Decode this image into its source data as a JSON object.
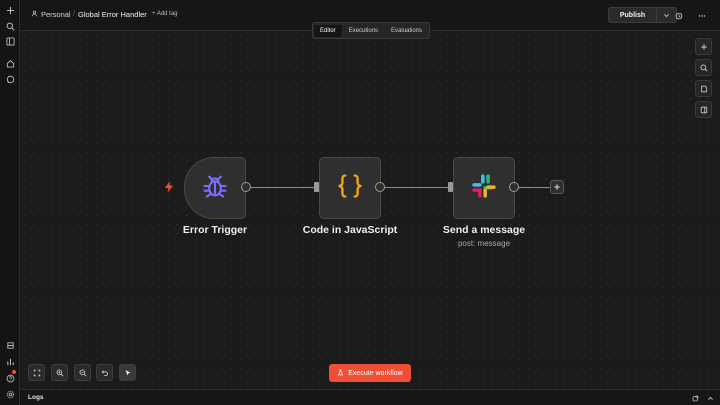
{
  "sidebar": {
    "top_icons": [
      "plus-icon",
      "search-icon",
      "panel-icon",
      "home-icon",
      "chat-icon"
    ],
    "bottom_icons": [
      "templates-icon",
      "insights-icon",
      "help-icon",
      "settings-icon"
    ]
  },
  "header": {
    "project": "Personal",
    "workflow_title": "Global Error Handler",
    "add_tag": "+ Add tag",
    "publish_label": "Publish"
  },
  "tabs": [
    {
      "label": "Editor",
      "active": true
    },
    {
      "label": "Executions",
      "active": false
    },
    {
      "label": "Evaluations",
      "active": false
    }
  ],
  "canvas_tools": [
    "add-node-icon",
    "search-icon",
    "sticky-note-icon",
    "panel-toggle-icon"
  ],
  "nodes": [
    {
      "label": "Error Trigger",
      "subtitle": "",
      "icon": "bug-icon",
      "icon_color": "#7f6cff"
    },
    {
      "label": "Code in JavaScript",
      "subtitle": "",
      "icon": "braces-icon",
      "icon_color": "#f7a21b"
    },
    {
      "label": "Send a message",
      "subtitle": "post: message",
      "icon": "slack-icon",
      "icon_color": "#e01e5a"
    }
  ],
  "bottom_tools": [
    "fit-view-icon",
    "zoom-in-icon",
    "zoom-out-icon",
    "undo-icon",
    "pointer-icon"
  ],
  "execute_label": "Execute workflow",
  "logs_label": "Logs",
  "colors": {
    "accent": "#ef4f34",
    "canvas_bg": "#1b1b1b",
    "node_bg": "#2f2f2f"
  }
}
